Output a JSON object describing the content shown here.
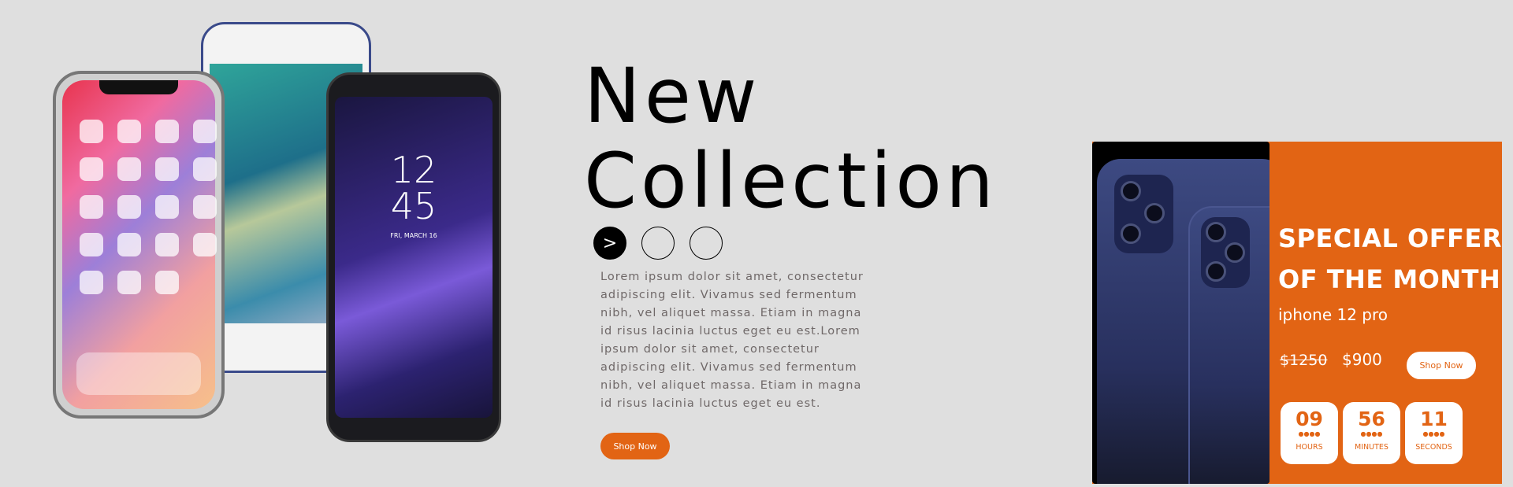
{
  "hero": {
    "title_line1": "New",
    "title_line2": "Collection",
    "slider_next_icon": ">",
    "description": "Lorem ipsum dolor sit amet, consectetur adipiscing elit. Vivamus sed fermentum nibh, vel aliquet massa. Etiam in magna id risus lacinia luctus eget eu est.Lorem ipsum dolor sit amet, consectetur adipiscing elit. Vivamus sed fermentum nibh, vel aliquet massa. Etiam in magna id risus lacinia luctus eget eu est.",
    "shop_now_label": "Shop Now",
    "phone_clock_hour": "12",
    "phone_clock_min": "45",
    "phone_date": "FRI, MARCH 16"
  },
  "offer": {
    "title": "SPECIAL OFFER OF THE MONTH",
    "product": "iphone 12 pro",
    "old_price": "$1250",
    "new_price": "$900",
    "shop_now_label": "Shop Now",
    "countdown": [
      {
        "value": "09",
        "label": "HOURS"
      },
      {
        "value": "56",
        "label": "MINUTES"
      },
      {
        "value": "11",
        "label": "SECONDS"
      }
    ],
    "accent_color": "#e26414"
  }
}
